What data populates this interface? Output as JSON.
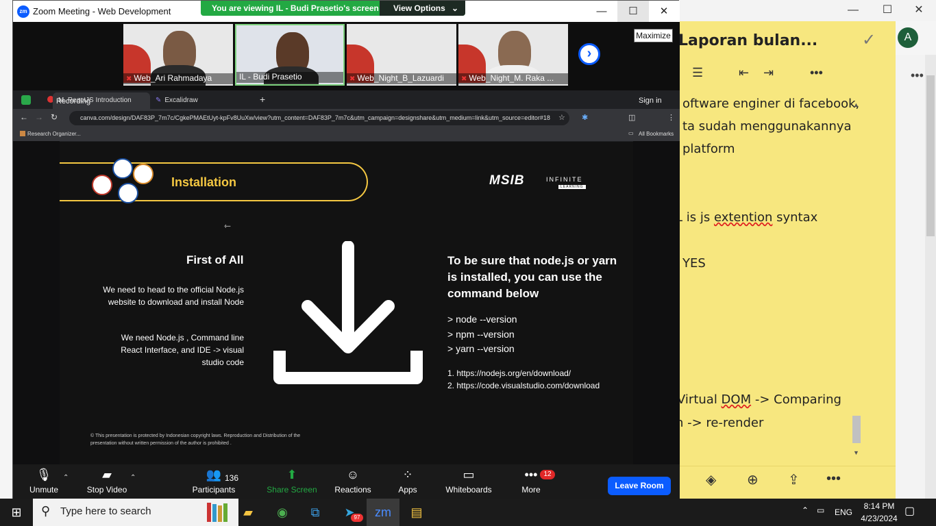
{
  "notes": {
    "title": "Laporan bulan...",
    "avatar": "A",
    "lines": [
      "oftware enginer di facebook,",
      "ta sudah menggunakannya",
      "platform",
      "L is js extention syntax",
      "YES",
      "Virtual DOM -> Comparing",
      "n -> re-render"
    ],
    "underlined_words": [
      "extention",
      "DOM"
    ],
    "accent_color": "#f7e77f"
  },
  "zoom": {
    "window_title": "Zoom Meeting - Web Development",
    "viewing_text": "You are viewing IL - Budi Prasetio's screen",
    "view_options_label": "View Options",
    "maximize_tooltip": "Maximize",
    "participants": [
      {
        "name": "Web_Ari Rahmadaya",
        "muted": true
      },
      {
        "name": "IL - Budi Prasetio",
        "muted": false
      },
      {
        "name": "Web_Night_B_Lazuardi",
        "muted": true
      },
      {
        "name": "Web_Night_M. Raka ...",
        "muted": true
      }
    ],
    "controls": {
      "unmute": "Unmute",
      "stop_video": "Stop Video",
      "participants": "Participants",
      "participant_count": "136",
      "share_screen": "Share Screen",
      "reactions": "Reactions",
      "apps": "Apps",
      "whiteboards": "Whiteboards",
      "more": "More",
      "more_badge": "12",
      "leave": "Leave Room"
    },
    "brand_color": "#0b5cff",
    "share_color": "#23a943"
  },
  "browser": {
    "recording": "Recording",
    "tab_active": "M. ReactJS Introduction",
    "tab_other": "Excalidraw",
    "sign_in": "Sign in",
    "url": "canva.com/design/DAF83P_7m7c/CgkePMAEtUyt-kpFv8UuXw/view?utm_content=DAF83P_7m7c&utm_campaign=designshare&utm_medium=link&utm_source=editor#18",
    "bookmark": "Research Organizer...",
    "all_bookmarks": "All Bookmarks"
  },
  "slide": {
    "banner_title": "Installation",
    "logo_msib": "MSIB",
    "logo_infinite": "INFINITE",
    "logo_learning": "LEARNING",
    "left_heading": "First of All",
    "left_p1": "We need to head to the official Node.js website to download and install Node",
    "left_p2": "We need Node.js , Command line React Interface, and IDE -> visual studio code",
    "right_heading": "To be sure that node.js or yarn is installed, you can use the command below",
    "commands": [
      "> node --version",
      "> npm --version",
      "> yarn --version"
    ],
    "links": [
      "1. https://nodejs.org/en/download/",
      "2. https://code.visualstudio.com/download"
    ],
    "copyright": "© This presentation is protected by Indonesian copyright laws. Reproduction and Distribution of the presentation without written permission of the author is prohibited .",
    "accent_color": "#f5c842"
  },
  "taskbar": {
    "search_placeholder": "Type here to search",
    "telegram_badge": "97",
    "language": "ENG",
    "time": "8:14 PM",
    "date": "4/23/2024"
  }
}
